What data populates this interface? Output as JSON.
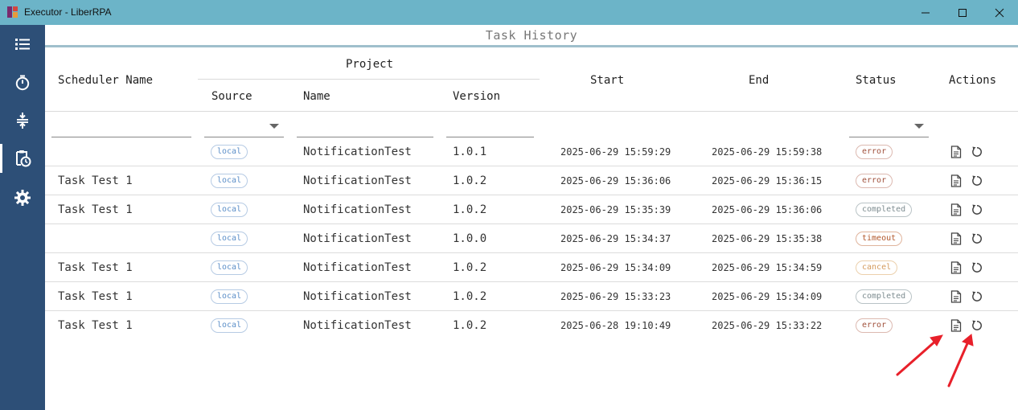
{
  "window": {
    "title": "Executor - LiberRPA"
  },
  "sidebar": {
    "items": [
      {
        "name": "list",
        "icon": "list-icon",
        "active": false
      },
      {
        "name": "timer",
        "icon": "timer-icon",
        "active": false
      },
      {
        "name": "compress",
        "icon": "vertical-compress-icon",
        "active": false
      },
      {
        "name": "task-history",
        "icon": "clipboard-clock-icon",
        "active": true
      },
      {
        "name": "settings",
        "icon": "gear-icon",
        "active": false
      }
    ]
  },
  "page": {
    "title": "Task History"
  },
  "columns": {
    "scheduler_name": "Scheduler Name",
    "project": "Project",
    "source": "Source",
    "name": "Name",
    "version": "Version",
    "start": "Start",
    "end": "End",
    "status": "Status",
    "actions": "Actions"
  },
  "rows": [
    {
      "scheduler": "",
      "source": "local",
      "name": "NotificationTest",
      "version": "1.0.1",
      "start": "2025-06-29 15:59:29",
      "end": "2025-06-29 15:59:38",
      "status": "error"
    },
    {
      "scheduler": "Task Test 1",
      "source": "local",
      "name": "NotificationTest",
      "version": "1.0.2",
      "start": "2025-06-29 15:36:06",
      "end": "2025-06-29 15:36:15",
      "status": "error"
    },
    {
      "scheduler": "Task Test 1",
      "source": "local",
      "name": "NotificationTest",
      "version": "1.0.2",
      "start": "2025-06-29 15:35:39",
      "end": "2025-06-29 15:36:06",
      "status": "completed"
    },
    {
      "scheduler": "",
      "source": "local",
      "name": "NotificationTest",
      "version": "1.0.0",
      "start": "2025-06-29 15:34:37",
      "end": "2025-06-29 15:35:38",
      "status": "timeout"
    },
    {
      "scheduler": "Task Test 1",
      "source": "local",
      "name": "NotificationTest",
      "version": "1.0.2",
      "start": "2025-06-29 15:34:09",
      "end": "2025-06-29 15:34:59",
      "status": "cancel"
    },
    {
      "scheduler": "Task Test 1",
      "source": "local",
      "name": "NotificationTest",
      "version": "1.0.2",
      "start": "2025-06-29 15:33:23",
      "end": "2025-06-29 15:34:09",
      "status": "completed"
    },
    {
      "scheduler": "Task Test 1",
      "source": "local",
      "name": "NotificationTest",
      "version": "1.0.2",
      "start": "2025-06-28 19:10:49",
      "end": "2025-06-29 15:33:22",
      "status": "error"
    }
  ],
  "actions": {
    "log_icon": "document-icon",
    "rerun_icon": "rerun-icon"
  },
  "annotation": {
    "arrow_color": "#e8202a",
    "targets": [
      "document-icon",
      "rerun-icon"
    ]
  },
  "colors": {
    "titlebar": "#6cb4c8",
    "sidebar": "#2d4f77",
    "header_rule": "#9fbfcc"
  }
}
